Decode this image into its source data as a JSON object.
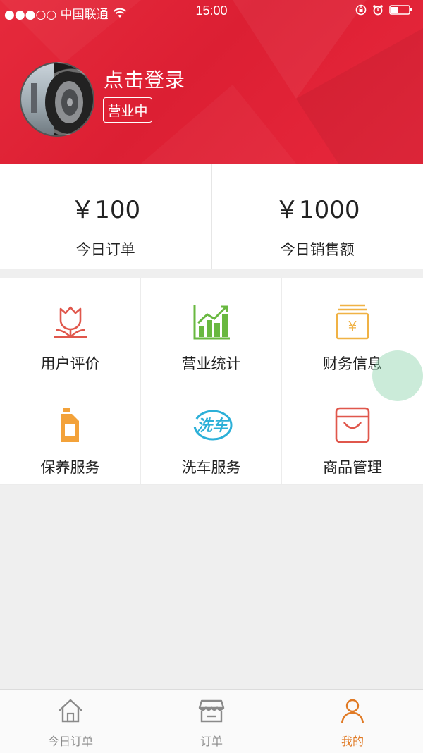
{
  "status_bar": {
    "carrier": "●●●○○ 中国联通",
    "time": "15:00"
  },
  "profile": {
    "login_text": "点击登录",
    "status_tag": "营业中"
  },
  "stats": [
    {
      "value": "￥100",
      "label": "今日订单"
    },
    {
      "value": "￥1000",
      "label": "今日销售额"
    }
  ],
  "grid": [
    {
      "label": "用户评价",
      "icon": "tulip-icon",
      "color": "#e0574c"
    },
    {
      "label": "营业统计",
      "icon": "bar-chart-icon",
      "color": "#69b840"
    },
    {
      "label": "财务信息",
      "icon": "wallet-yen-icon",
      "color": "#f0b245"
    },
    {
      "label": "保养服务",
      "icon": "oil-bottle-icon",
      "color": "#f3a23a"
    },
    {
      "label": "洗车服务",
      "icon": "car-wash-icon",
      "color": "#2cb0d8"
    },
    {
      "label": "商品管理",
      "icon": "shopping-bag-icon",
      "color": "#e0574c"
    }
  ],
  "tabbar": {
    "tabs": [
      {
        "label": "今日订单",
        "icon": "home-icon"
      },
      {
        "label": "订单",
        "icon": "store-icon"
      },
      {
        "label": "我的",
        "icon": "user-icon"
      }
    ],
    "active_color": "#e07a25"
  },
  "colors": {
    "header_red": "#e0283b",
    "page_bg": "#efefef"
  }
}
